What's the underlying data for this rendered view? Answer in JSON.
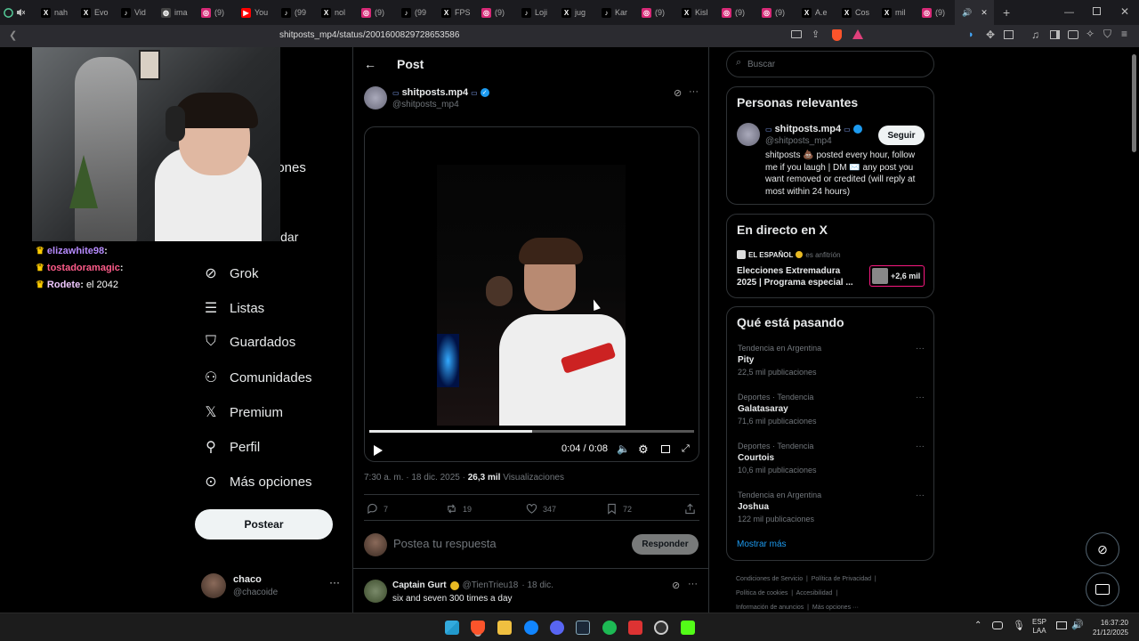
{
  "tabs": [
    {
      "label": "nah",
      "icon": "x-icon",
      "color": "#000000"
    },
    {
      "label": "Evo",
      "icon": "x-icon",
      "color": "#000000"
    },
    {
      "label": "Vid",
      "icon": "tiktok-icon",
      "color": "#000000"
    },
    {
      "label": "ima",
      "icon": "globe-icon",
      "color": "#444444"
    },
    {
      "label": "(9)",
      "icon": "instagram-icon",
      "color": "#d62976"
    },
    {
      "label": "You",
      "icon": "youtube-icon",
      "color": "#ff0000"
    },
    {
      "label": "(99",
      "icon": "tiktok-icon",
      "color": "#000000"
    },
    {
      "label": "nol",
      "icon": "x-icon",
      "color": "#000000"
    },
    {
      "label": "(9)",
      "icon": "instagram-icon",
      "color": "#d62976"
    },
    {
      "label": "(99",
      "icon": "tiktok-icon",
      "color": "#000000"
    },
    {
      "label": "FPS",
      "icon": "x-icon",
      "color": "#000000"
    },
    {
      "label": "(9)",
      "icon": "instagram-icon",
      "color": "#d62976"
    },
    {
      "label": "Loji",
      "icon": "tiktok-icon",
      "color": "#000000"
    },
    {
      "label": "jug",
      "icon": "x-icon",
      "color": "#000000"
    },
    {
      "label": "Kar",
      "icon": "tiktok-icon",
      "color": "#000000"
    },
    {
      "label": "(9)",
      "icon": "instagram-icon",
      "color": "#d62976"
    },
    {
      "label": "Kisl",
      "icon": "x-icon",
      "color": "#000000"
    },
    {
      "label": "(9)",
      "icon": "instagram-icon",
      "color": "#d62976"
    },
    {
      "label": "(9)",
      "icon": "instagram-icon",
      "color": "#d62976"
    },
    {
      "label": "A.e",
      "icon": "x-icon",
      "color": "#000000"
    },
    {
      "label": "Cos",
      "icon": "x-icon",
      "color": "#000000"
    },
    {
      "label": "mil",
      "icon": "x-icon",
      "color": "#000000"
    },
    {
      "label": "(9)",
      "icon": "instagram-icon",
      "color": "#d62976"
    }
  ],
  "url": "shitposts_mp4/status/2001600829728653586",
  "chat": [
    {
      "user": "elizawhite98",
      "sep": ":",
      "msg": "",
      "color": "#b78bff"
    },
    {
      "user": "tostadoramagic",
      "sep": ":",
      "msg": "",
      "color": "#ff5c8a"
    },
    {
      "user": "Rodete",
      "sep": ":",
      "msg": "el 2042",
      "color": "#f0c8ff"
    }
  ],
  "nav": {
    "partial_top": "iones",
    "partial_cut": "Guardar",
    "items": [
      {
        "label": "Grok",
        "icon": "grok-icon"
      },
      {
        "label": "Listas",
        "icon": "lists-icon"
      },
      {
        "label": "Guardados",
        "icon": "bookmark-icon"
      },
      {
        "label": "Comunidades",
        "icon": "communities-icon"
      },
      {
        "label": "Premium",
        "icon": "x-logo-icon"
      },
      {
        "label": "Perfil",
        "icon": "profile-icon"
      },
      {
        "label": "Más opciones",
        "icon": "more-circle-icon"
      }
    ],
    "post_button": "Postear"
  },
  "current_user": {
    "name": "chaco",
    "handle": "@chacoide"
  },
  "post": {
    "header": "Post",
    "author_name": "shitposts.mp4",
    "author_handle": "@shitposts_mp4",
    "video_time": "0:04 / 0:08",
    "video_progress": 0.5,
    "timestamp": "7:30 a. m. · 18 dic. 2025 ·",
    "views_count": "26,3 mil",
    "views_label": "Visualizaciones",
    "replies": "7",
    "reposts": "19",
    "likes": "347",
    "bookmarks": "72",
    "reply_placeholder": "Postea tu respuesta",
    "reply_button": "Responder"
  },
  "reply": {
    "name": "Captain Gurt",
    "handle": "@TienTrieu18",
    "date": "· 18 dic.",
    "text": "six and seven 300 times a day"
  },
  "search_placeholder": "Buscar",
  "relevant": {
    "title": "Personas relevantes",
    "name": "shitposts.mp4",
    "handle": "@shitposts_mp4",
    "follow": "Seguir",
    "bio": "shitposts 💩 posted every hour, follow me if you laugh | DM ✉️ any post you want removed or credited (will reply at most within 24 hours)"
  },
  "live": {
    "title": "En directo en X",
    "host": "EL ESPAÑOL",
    "host_role": "es anfitrión",
    "event": "Elecciones Extremadura 2025 | Programa especial ...",
    "listeners": "+2,6 mil"
  },
  "trends": {
    "title": "Qué está pasando",
    "items": [
      {
        "meta": "Tendencia en Argentina",
        "name": "Pity",
        "count": "22,5 mil publicaciones"
      },
      {
        "meta": "Deportes · Tendencia",
        "name": "Galatasaray",
        "count": "71,6 mil publicaciones"
      },
      {
        "meta": "Deportes · Tendencia",
        "name": "Courtois",
        "count": "10,6 mil publicaciones"
      },
      {
        "meta": "Tendencia en Argentina",
        "name": "Joshua",
        "count": "122 mil publicaciones"
      }
    ],
    "more": "Mostrar más"
  },
  "footer": {
    "line1": [
      "Condiciones de Servicio",
      "Política de Privacidad"
    ],
    "line2": [
      "Política de cookies",
      "Accesibilidad"
    ],
    "line3": [
      "Información de anuncios",
      "Más opciones ···"
    ]
  },
  "system": {
    "lang1": "ESP",
    "lang2": "LAA",
    "time": "16:37:20",
    "date": "21/12/2025"
  },
  "colors": {
    "accent": "#1d9bf0",
    "link": "#1d9bf0",
    "border": "#2f3336",
    "muted": "#71767b"
  }
}
